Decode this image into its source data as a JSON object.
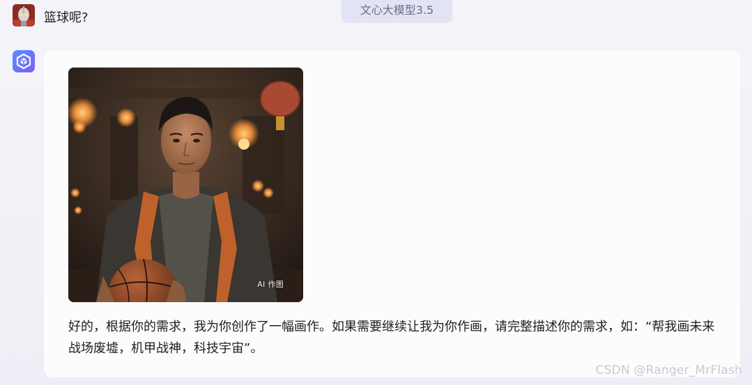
{
  "header": {
    "model_label": "文心大模型3.5"
  },
  "user_message": {
    "avatar_icon": "ultraman-avatar-icon",
    "text": "篮球呢?"
  },
  "assistant_message": {
    "avatar_icon": "ernie-bot-cube-icon",
    "image": {
      "badge": "AI 作图"
    },
    "text": "好的，根据你的需求，我为你创作了一幅画作。如果需要继续让我为你作画，请完整描述你的需求，如：“帮我画未来战场废墟，机甲战神，科技宇宙”。"
  },
  "watermark": {
    "text": "CSDN @Ranger_MrFlash"
  },
  "colors": {
    "page_bg": "#f3f3f7",
    "card_bg": "#fcfcfd",
    "badge_bg": "#e2e3f5",
    "bot_icon_gradient_start": "#5b8cff",
    "bot_icon_gradient_end": "#7a5cff"
  }
}
